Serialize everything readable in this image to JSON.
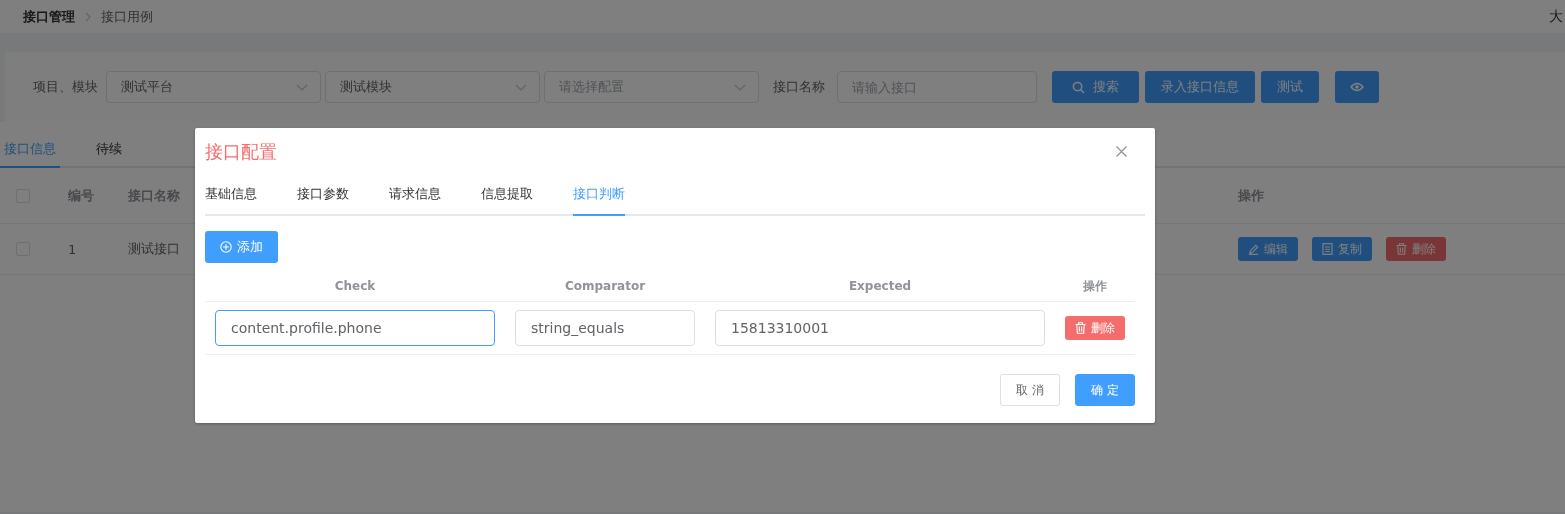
{
  "breadcrumb": [
    "接口管理",
    "接口用例"
  ],
  "user": "大",
  "filter": {
    "label": "项目、模块",
    "selects": [
      {
        "value": "测试平台"
      },
      {
        "value": "测试模块"
      },
      {
        "placeholder": "请选择配置"
      }
    ],
    "name_label": "接口名称",
    "name_placeholder": "请输入接口",
    "buttons": [
      {
        "kind": "search",
        "label": "搜索"
      },
      {
        "kind": "text",
        "label": "录入接口信息"
      },
      {
        "kind": "text",
        "label": "测试"
      },
      {
        "kind": "eye"
      }
    ]
  },
  "tabs": [
    {
      "label": "接口信息",
      "selected": true
    },
    {
      "label": "待续",
      "selected": false
    }
  ],
  "table": {
    "header_checked": false,
    "columns": [
      "编号",
      "接口名称",
      "操作"
    ],
    "rows": [
      {
        "checked": false,
        "number": "1",
        "name": "测试接口",
        "actions": [
          {
            "kind": "edit",
            "label": "编辑"
          },
          {
            "kind": "copy",
            "label": "复制"
          },
          {
            "kind": "delete",
            "label": "删除"
          }
        ]
      }
    ]
  },
  "dialog": {
    "title": "接口配置",
    "tabs": [
      {
        "label": "基础信息",
        "selected": false
      },
      {
        "label": "接口参数",
        "selected": false
      },
      {
        "label": "请求信息",
        "selected": false
      },
      {
        "label": "信息提取",
        "selected": false
      },
      {
        "label": "接口判断",
        "selected": true
      }
    ],
    "add_button": "添加",
    "columns": [
      "Check",
      "Comparator",
      "Expected",
      "操作"
    ],
    "rows": [
      {
        "fields": [
          {
            "value": "content.profile.phone",
            "focused": true
          },
          {
            "value": "string_equals",
            "focused": false
          },
          {
            "value": "15813310001",
            "focused": false
          }
        ],
        "delete": "删除"
      }
    ],
    "footer": [
      {
        "kind": "default",
        "label": "取 消"
      },
      {
        "kind": "primary",
        "label": "确 定"
      }
    ]
  }
}
